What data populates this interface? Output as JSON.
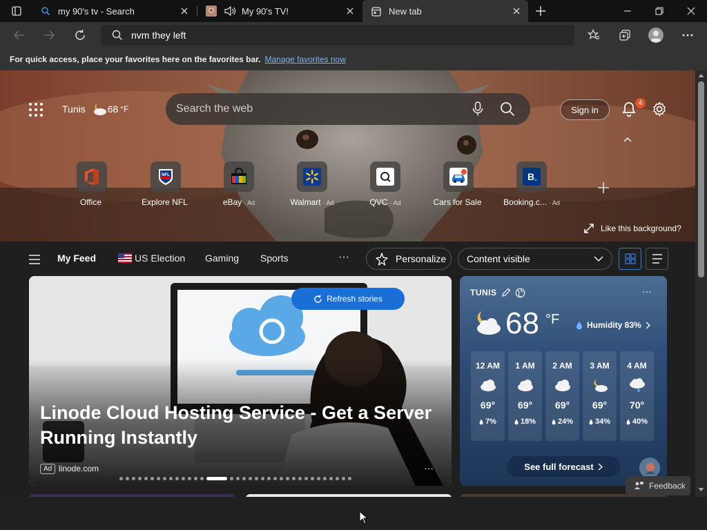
{
  "tabs": [
    {
      "title": "my 90's tv - Search",
      "icon": "search-icon"
    },
    {
      "title": "My 90's TV!",
      "icon": "site-favicon"
    },
    {
      "title": "New tab",
      "icon": "new-tab-icon"
    }
  ],
  "toolbar": {
    "address_value": "nvm they left"
  },
  "favbar": {
    "message": "For quick access, place your favorites here on the favorites bar.",
    "link": "Manage favorites now"
  },
  "hero": {
    "city": "Tunis",
    "temp": "68",
    "temp_unit": "°F",
    "search_placeholder": "Search the web",
    "sign_in": "Sign in",
    "notification_count": "4",
    "like_background": "Like this background?"
  },
  "tiles": [
    {
      "label": "Office",
      "ad": ""
    },
    {
      "label": "Explore NFL",
      "ad": ""
    },
    {
      "label": "eBay",
      "ad": "· Ad"
    },
    {
      "label": "Walmart",
      "ad": "· Ad"
    },
    {
      "label": "QVC",
      "ad": "· Ad"
    },
    {
      "label": "Cars for Sale",
      "ad": ""
    },
    {
      "label": "Booking.c...",
      "ad": "· Ad"
    }
  ],
  "feednav": {
    "items": [
      "My Feed",
      "US Election",
      "Gaming",
      "Sports"
    ],
    "more": "···",
    "personalize": "Personalize",
    "content_visible": "Content visible"
  },
  "maincard": {
    "headline": "Linode Cloud Hosting Service - Get a Server Running Instantly",
    "ad_tag": "Ad",
    "source": "linode.com",
    "more": "···",
    "refresh": "Refresh stories",
    "carousel_total": 35,
    "carousel_active": 14
  },
  "weather": {
    "city": "TUNIS",
    "temp": "68",
    "unit": "°F",
    "humidity": "Humidity 83%",
    "more": "···",
    "hours": [
      {
        "time": "12 AM",
        "temp": "69°",
        "precip": "7%",
        "icon": "cloud-icon"
      },
      {
        "time": "1 AM",
        "temp": "69°",
        "precip": "18%",
        "icon": "cloud-icon"
      },
      {
        "time": "2 AM",
        "temp": "69°",
        "precip": "24%",
        "icon": "cloud-icon"
      },
      {
        "time": "3 AM",
        "temp": "69°",
        "precip": "34%",
        "icon": "partly-cloudy-icon"
      },
      {
        "time": "4 AM",
        "temp": "70°",
        "precip": "40%",
        "icon": "rain-cloud-icon"
      }
    ],
    "full_forecast": "See full forecast"
  },
  "feedback": "Feedback",
  "colors": {
    "accent": "#1a6fd6",
    "link": "#7ab3f5",
    "badge": "#e0562b"
  }
}
